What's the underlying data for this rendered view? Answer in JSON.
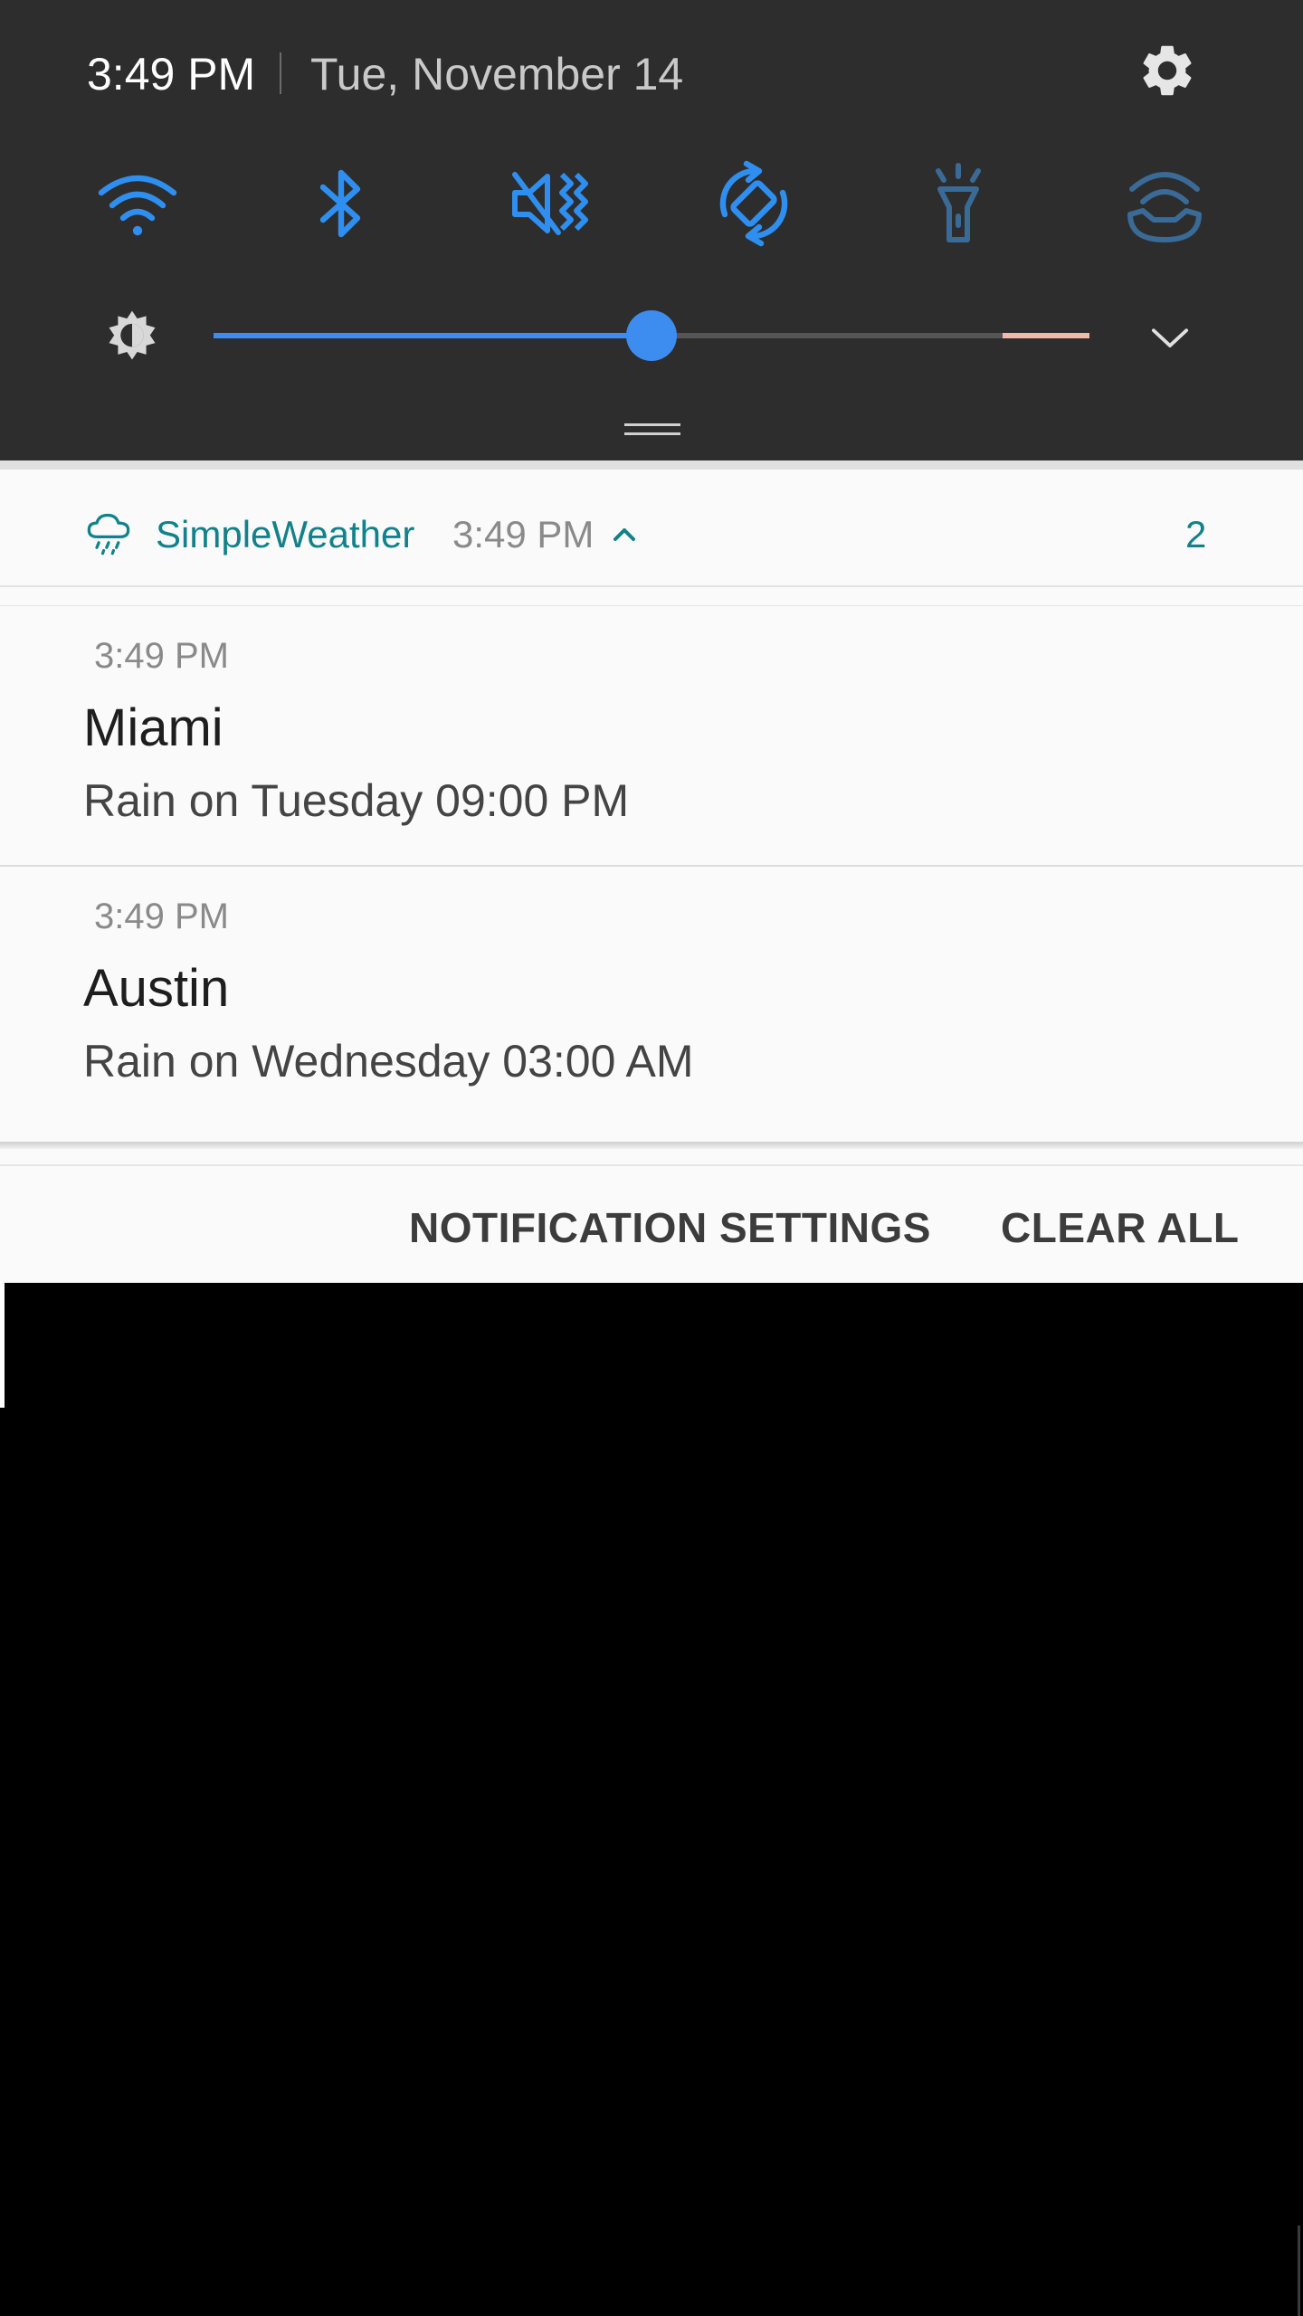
{
  "status": {
    "time": "3:49 PM",
    "date": "Tue, November 14"
  },
  "quick_toggles": [
    {
      "name": "wifi",
      "icon": "wifi-icon",
      "state": "on",
      "color": "#2f8ff0"
    },
    {
      "name": "bluetooth",
      "icon": "bluetooth-icon",
      "state": "on",
      "color": "#2f8ff0"
    },
    {
      "name": "sound",
      "icon": "vibrate-mute-icon",
      "state": "on",
      "color": "#2f8ff0"
    },
    {
      "name": "auto-rotate",
      "icon": "rotate-icon",
      "state": "on",
      "color": "#2f8ff0"
    },
    {
      "name": "flashlight",
      "icon": "flashlight-icon",
      "state": "off",
      "color": "#3a6a96"
    },
    {
      "name": "hotspot",
      "icon": "hotspot-icon",
      "state": "off",
      "color": "#3a6a96"
    }
  ],
  "brightness": {
    "level": 0.5
  },
  "notification_group": {
    "app_name": "SimpleWeather",
    "time": "3:49 PM",
    "count": "2",
    "accent": "#12828a"
  },
  "notifications": [
    {
      "time": "3:49 PM",
      "title": "Miami",
      "text": "Rain on Tuesday 09:00 PM"
    },
    {
      "time": "3:49 PM",
      "title": "Austin",
      "text": "Rain on Wednesday 03:00 AM"
    }
  ],
  "actions": {
    "settings_label": "NOTIFICATION SETTINGS",
    "clear_label": "CLEAR ALL"
  }
}
